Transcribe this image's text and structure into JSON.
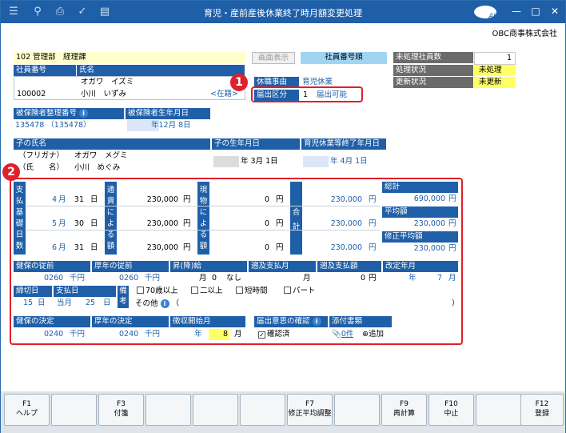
{
  "window": {
    "title": "育児・産前産後休業終了時月額変更処理",
    "company": "OBC商事株式会社"
  },
  "toolbar": {
    "button": "画面表示",
    "order": "社員番号順"
  },
  "status": {
    "unprocessed_label": "未処理社員数",
    "unprocessed_count": "1",
    "proc_label": "処理状況",
    "proc_value": "未処理",
    "update_label": "更新状況",
    "update_value": "未更新"
  },
  "employee": {
    "dept": "102 管理部　経理課",
    "no_label": "社員番号",
    "name_label": "氏名",
    "kana": "オガワ　イズミ",
    "name": "小川　いずみ",
    "no": "100002",
    "status": "<在籍>"
  },
  "leave": {
    "reason_label": "休職事由",
    "reason": "育児休業",
    "category_label": "届出区分",
    "category_no": "1",
    "category": "届出可能"
  },
  "insured": {
    "label": "被保険者整理番号",
    "value": "135478 （135478）",
    "birth_label": "被保険者生年月日",
    "birth": "年12月  8日"
  },
  "child": {
    "name_label": "子の氏名",
    "kana_label": "（フリガナ）",
    "kana": "オガワ　メグミ",
    "name_label2": "（氏　　名）",
    "name": "小川　めぐみ",
    "birth_label": "子の生年月日",
    "birth": "年  3月  1日",
    "end_label": "育児休業等終了年月日",
    "end": "年  4月  1日"
  },
  "pay": {
    "vlabel1": "支払基礎日数",
    "vlabel2": "通貨による額",
    "vlabel3": "現物による額",
    "vlabel4": "合計",
    "rows": [
      {
        "month": "4",
        "month_u": "月",
        "days": "31",
        "days_u": "日",
        "cash": "230,000",
        "yen1": "円",
        "kind": "0",
        "yen2": "円",
        "total": "230,000",
        "yen3": "円"
      },
      {
        "month": "5",
        "month_u": "月",
        "days": "30",
        "days_u": "日",
        "cash": "230,000",
        "yen1": "円",
        "kind": "0",
        "yen2": "円",
        "total": "230,000",
        "yen3": "円"
      },
      {
        "month": "6",
        "month_u": "月",
        "days": "31",
        "days_u": "日",
        "cash": "230,000",
        "yen1": "円",
        "kind": "0",
        "yen2": "円",
        "total": "230,000",
        "yen3": "円"
      }
    ],
    "sum_label": "総計",
    "sum": "690,000",
    "avg_label": "平均額",
    "avg": "230,000",
    "mavg_label": "修正平均額",
    "mavg": "230,000",
    "yen": "円"
  },
  "prev": {
    "health_label": "健保の従前",
    "health": "0260",
    "unit": "千円",
    "pension_label": "厚年の従前",
    "pension": "0260",
    "raise_label": "昇(降)給",
    "raise_m": "月",
    "raise_v": "0",
    "raise_none": "なし",
    "retro_label": "遡及支払月",
    "retro_m": "月",
    "retro_amt_label": "遡及支払額",
    "retro_amt": "0",
    "yen": "円",
    "rev_label": "改定年月",
    "rev": "年",
    "rev_m": "7",
    "rev_mu": "月"
  },
  "cutoff": {
    "close_label": "締切日",
    "close": "15",
    "close_u": "日",
    "pay_label": "支払日",
    "pay_a": "当月",
    "pay_d": "25",
    "pay_u": "日",
    "note_label": "備考",
    "opt1": "70歳以上",
    "opt2": "二以上",
    "opt3": "短時間",
    "opt4": "パート",
    "other": "その他",
    "paren_l": "（",
    "paren_r": "）"
  },
  "decision": {
    "health_label": "健保の決定",
    "health": "0240",
    "unit": "千円",
    "pension_label": "厚年の決定",
    "pension": "0240",
    "start_label": "徴収開始月",
    "start_y": "年",
    "start_m": "8",
    "start_mu": "月",
    "confirm_label": "届出意思の確認",
    "confirmed": "確認済",
    "attach_label": "添付書類",
    "attach_count": "0件",
    "attach_add": "追加"
  },
  "badges": {
    "b1": "1",
    "b2": "2"
  },
  "fkeys": [
    {
      "k": "F1",
      "l": "ヘルプ"
    },
    {
      "k": "",
      "l": ""
    },
    {
      "k": "F3",
      "l": "付箋"
    },
    {
      "k": "",
      "l": ""
    },
    {
      "k": "",
      "l": ""
    },
    {
      "k": "",
      "l": ""
    },
    {
      "k": "F7",
      "l": "修正平均調整"
    },
    {
      "k": "",
      "l": ""
    },
    {
      "k": "F9",
      "l": "再計算"
    },
    {
      "k": "F10",
      "l": "中止"
    },
    {
      "k": "",
      "l": ""
    },
    {
      "k": "F12",
      "l": "登録"
    }
  ]
}
